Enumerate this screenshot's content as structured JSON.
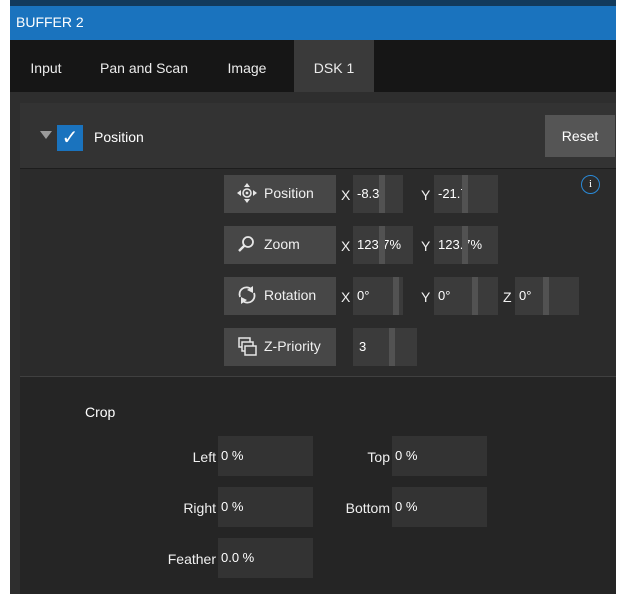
{
  "window": {
    "title": "BUFFER 2"
  },
  "tabs": [
    {
      "label": "Input",
      "active": false
    },
    {
      "label": "Pan and Scan",
      "active": false
    },
    {
      "label": "Image",
      "active": false
    },
    {
      "label": "DSK 1",
      "active": true
    }
  ],
  "position_section": {
    "title": "Position",
    "enabled": true,
    "reset_label": "Reset",
    "info_icon": "i",
    "position": {
      "label": "Position",
      "x_label": "X",
      "x_value": "-8.3",
      "y_label": "Y",
      "y_value": "-21.7"
    },
    "zoom": {
      "label": "Zoom",
      "x_label": "X",
      "x_value": "123.7%",
      "y_label": "Y",
      "y_value": "123.7%"
    },
    "rotation": {
      "label": "Rotation",
      "x_label": "X",
      "x_value": "0°",
      "y_label": "Y",
      "y_value": "0°",
      "z_label": "Z",
      "z_value": "0°"
    },
    "z_priority": {
      "label": "Z-Priority",
      "value": "3"
    }
  },
  "crop": {
    "title": "Crop",
    "left": {
      "label": "Left",
      "value": "0 %"
    },
    "top": {
      "label": "Top",
      "value": "0 %"
    },
    "right": {
      "label": "Right",
      "value": "0 %"
    },
    "bottom": {
      "label": "Bottom",
      "value": "0 %"
    },
    "feather": {
      "label": "Feather",
      "value": "0.0 %"
    }
  },
  "colors": {
    "accent": "#1a73be",
    "panel": "#2e2e2e",
    "button": "#474747",
    "field": "#3b3b3b"
  }
}
